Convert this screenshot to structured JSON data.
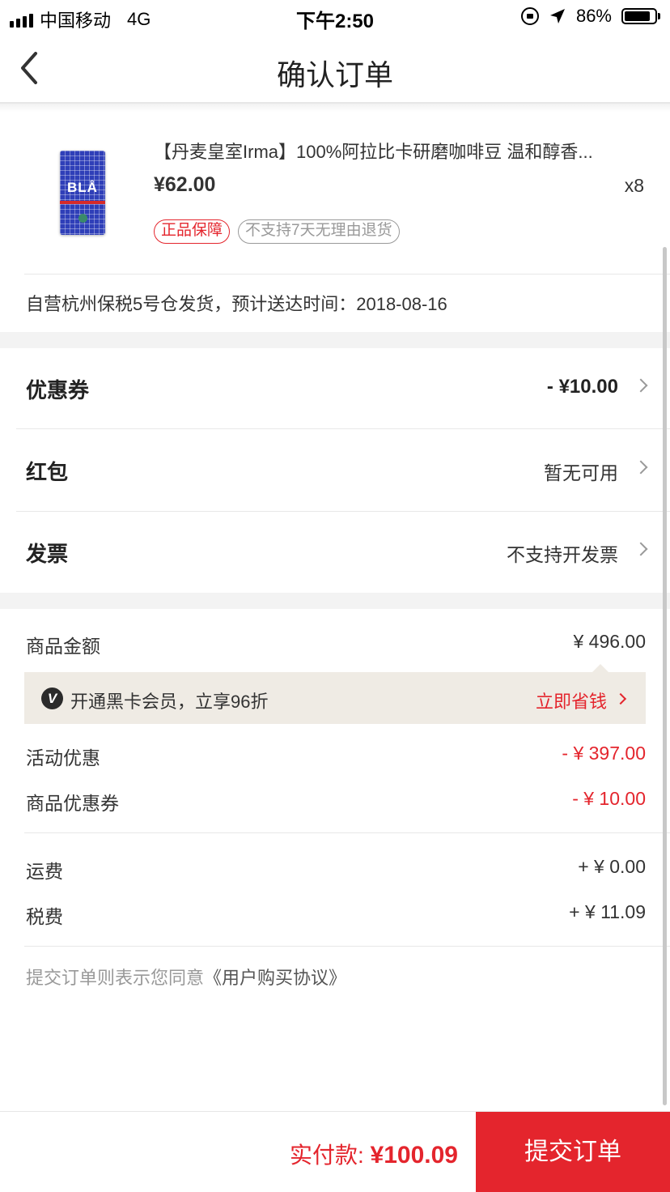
{
  "status_bar": {
    "carrier": "中国移动",
    "network": "4G",
    "time": "下午2:50",
    "battery": "86%",
    "battery_level": 0.86
  },
  "header": {
    "title": "确认订单",
    "back_icon": "chevron-left-icon"
  },
  "product": {
    "name": "【丹麦皇室Irma】100%阿拉比卡研磨咖啡豆  温和醇香...",
    "price": "¥62.00",
    "quantity": "x8",
    "image_brand": "BLÅ",
    "tags": [
      "正品保障",
      "不支持7天无理由退货"
    ]
  },
  "shipping": {
    "text": "自营杭州保税5号仓发货，预计送达时间：2018-08-16"
  },
  "options": [
    {
      "label": "优惠券",
      "value": "- ¥10.00"
    },
    {
      "label": "红包",
      "value": "暂无可用"
    },
    {
      "label": "发票",
      "value": "不支持开发票"
    }
  ],
  "summary": {
    "goods_amount": {
      "label": "商品金额",
      "value": "¥ 496.00"
    },
    "vip": {
      "text": "开通黑卡会员，立享96折",
      "action": "立即省钱",
      "icon_letter": "V"
    },
    "activity_discount": {
      "label": "活动优惠",
      "value": "- ¥ 397.00"
    },
    "coupon_discount": {
      "label": "商品优惠券",
      "value": "- ¥ 10.00"
    },
    "shipping_fee": {
      "label": "运费",
      "value": "+ ¥ 0.00"
    },
    "tax": {
      "label": "税费",
      "value": "+ ¥ 11.09"
    }
  },
  "agreement": {
    "prefix": "提交订单则表示您同意",
    "link": "《用户购买协议》"
  },
  "footer": {
    "pay_label": "实付款:",
    "pay_amount": "¥100.09",
    "submit": "提交订单"
  },
  "colors": {
    "accent": "#e4252d",
    "vip_bg": "#efebe4",
    "gap_bg": "#f3f3f3"
  }
}
